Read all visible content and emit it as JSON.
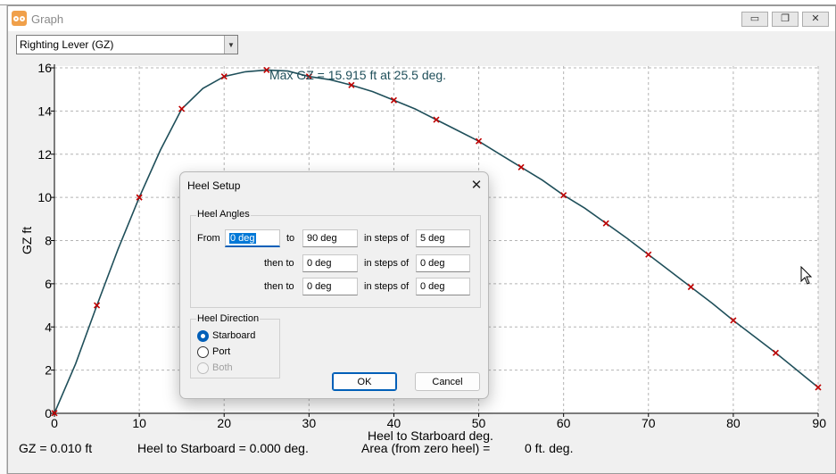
{
  "window": {
    "title": "Graph",
    "min_glyph": "▭",
    "max_glyph": "❐",
    "close_glyph": "✕"
  },
  "selector": {
    "selected": "Righting Lever (GZ)",
    "arrow_glyph": "▼"
  },
  "chart_data": {
    "type": "line",
    "ylabel": "GZ  ft",
    "xlabel": "Heel to Starboard   deg.",
    "xlim": [
      0,
      90
    ],
    "ylim": [
      0,
      16
    ],
    "xticks": [
      "0",
      "10",
      "20",
      "30",
      "40",
      "50",
      "60",
      "70",
      "80",
      "90"
    ],
    "yticks": [
      "0",
      "2",
      "4",
      "6",
      "8",
      "10",
      "12",
      "14",
      "16"
    ],
    "grid": true,
    "annotation": "Max GZ = 15.915 ft at 25.5 deg.",
    "line_color": "#1f4f5a",
    "marker_color": "#c00000",
    "curve": {
      "x": [
        0,
        2.5,
        5,
        7.5,
        10,
        12.5,
        15,
        17.5,
        20,
        22.5,
        25,
        27.5,
        30,
        32.5,
        35,
        37.5,
        40,
        42.5,
        45,
        47.5,
        50,
        52.5,
        55,
        57.5,
        60,
        62.5,
        65,
        67.5,
        70,
        72.5,
        75,
        77.5,
        80,
        82.5,
        85,
        87.5,
        90
      ],
      "y": [
        0.01,
        2.3,
        5.0,
        7.6,
        10.0,
        12.2,
        14.1,
        15.05,
        15.6,
        15.82,
        15.9,
        15.85,
        15.6,
        15.45,
        15.2,
        14.9,
        14.5,
        14.1,
        13.6,
        13.1,
        12.6,
        12.0,
        11.4,
        10.8,
        10.1,
        9.5,
        8.8,
        8.1,
        7.35,
        6.6,
        5.85,
        5.1,
        4.3,
        3.55,
        2.8,
        2.0,
        1.2
      ]
    },
    "markers": {
      "x": [
        0,
        5,
        10,
        15,
        20,
        25,
        30,
        35,
        40,
        45,
        50,
        55,
        60,
        65,
        70,
        75,
        80,
        85,
        90
      ],
      "y": [
        0.01,
        5.0,
        10.0,
        14.1,
        15.6,
        15.9,
        15.6,
        15.2,
        14.5,
        13.6,
        12.6,
        11.4,
        10.1,
        8.8,
        7.35,
        5.85,
        4.3,
        2.8,
        1.2
      ]
    }
  },
  "status": {
    "gz": "GZ =  0.010 ft",
    "heel": "Heel to Starboard =  0.000  deg.",
    "area_label": "Area (from zero heel) =",
    "area_value": "0 ft. deg."
  },
  "dialog": {
    "title": "Heel Setup",
    "close_glyph": "✕",
    "angles_group": "Heel Angles",
    "from_label": "From",
    "to_label": "to",
    "steps_label": "in steps of",
    "then_label": "then to",
    "from_value": "0 deg",
    "to_value": "90 deg",
    "step1": "5 deg",
    "then1": "0 deg",
    "step2": "0 deg",
    "then2": "0 deg",
    "step3": "0 deg",
    "direction_group": "Heel Direction",
    "starboard": "Starboard",
    "port": "Port",
    "both": "Both",
    "ok": "OK",
    "cancel": "Cancel"
  }
}
